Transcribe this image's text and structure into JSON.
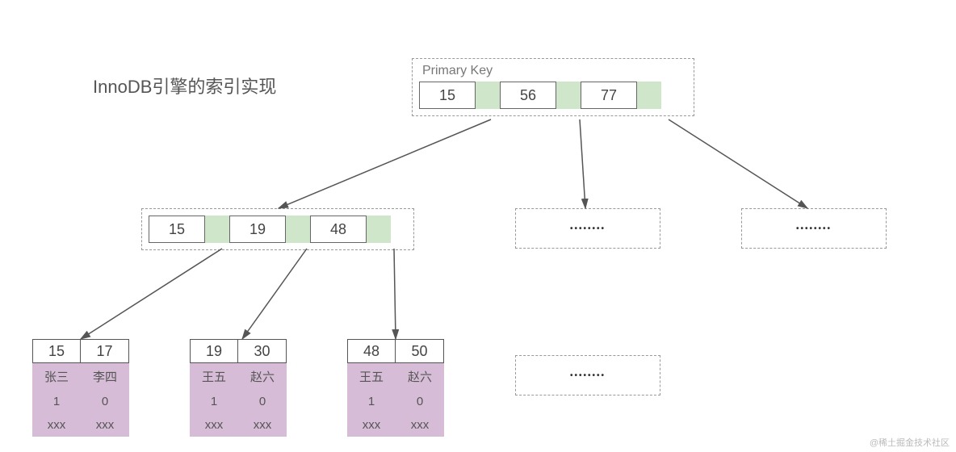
{
  "title": "InnoDB引擎的索引实现",
  "root": {
    "label": "Primary Key",
    "keys": [
      "15",
      "56",
      "77"
    ]
  },
  "internal": {
    "keys": [
      "15",
      "19",
      "48"
    ]
  },
  "leaves": [
    {
      "keys": [
        "15",
        "17"
      ],
      "rows": [
        [
          "张三",
          "李四"
        ],
        [
          "1",
          "0"
        ],
        [
          "xxx",
          "xxx"
        ]
      ]
    },
    {
      "keys": [
        "19",
        "30"
      ],
      "rows": [
        [
          "王五",
          "赵六"
        ],
        [
          "1",
          "0"
        ],
        [
          "xxx",
          "xxx"
        ]
      ]
    },
    {
      "keys": [
        "48",
        "50"
      ],
      "rows": [
        [
          "王五",
          "赵六"
        ],
        [
          "1",
          "0"
        ],
        [
          "xxx",
          "xxx"
        ]
      ]
    }
  ],
  "ellipsis": "••••••••",
  "watermark": "@稀土掘金技术社区"
}
